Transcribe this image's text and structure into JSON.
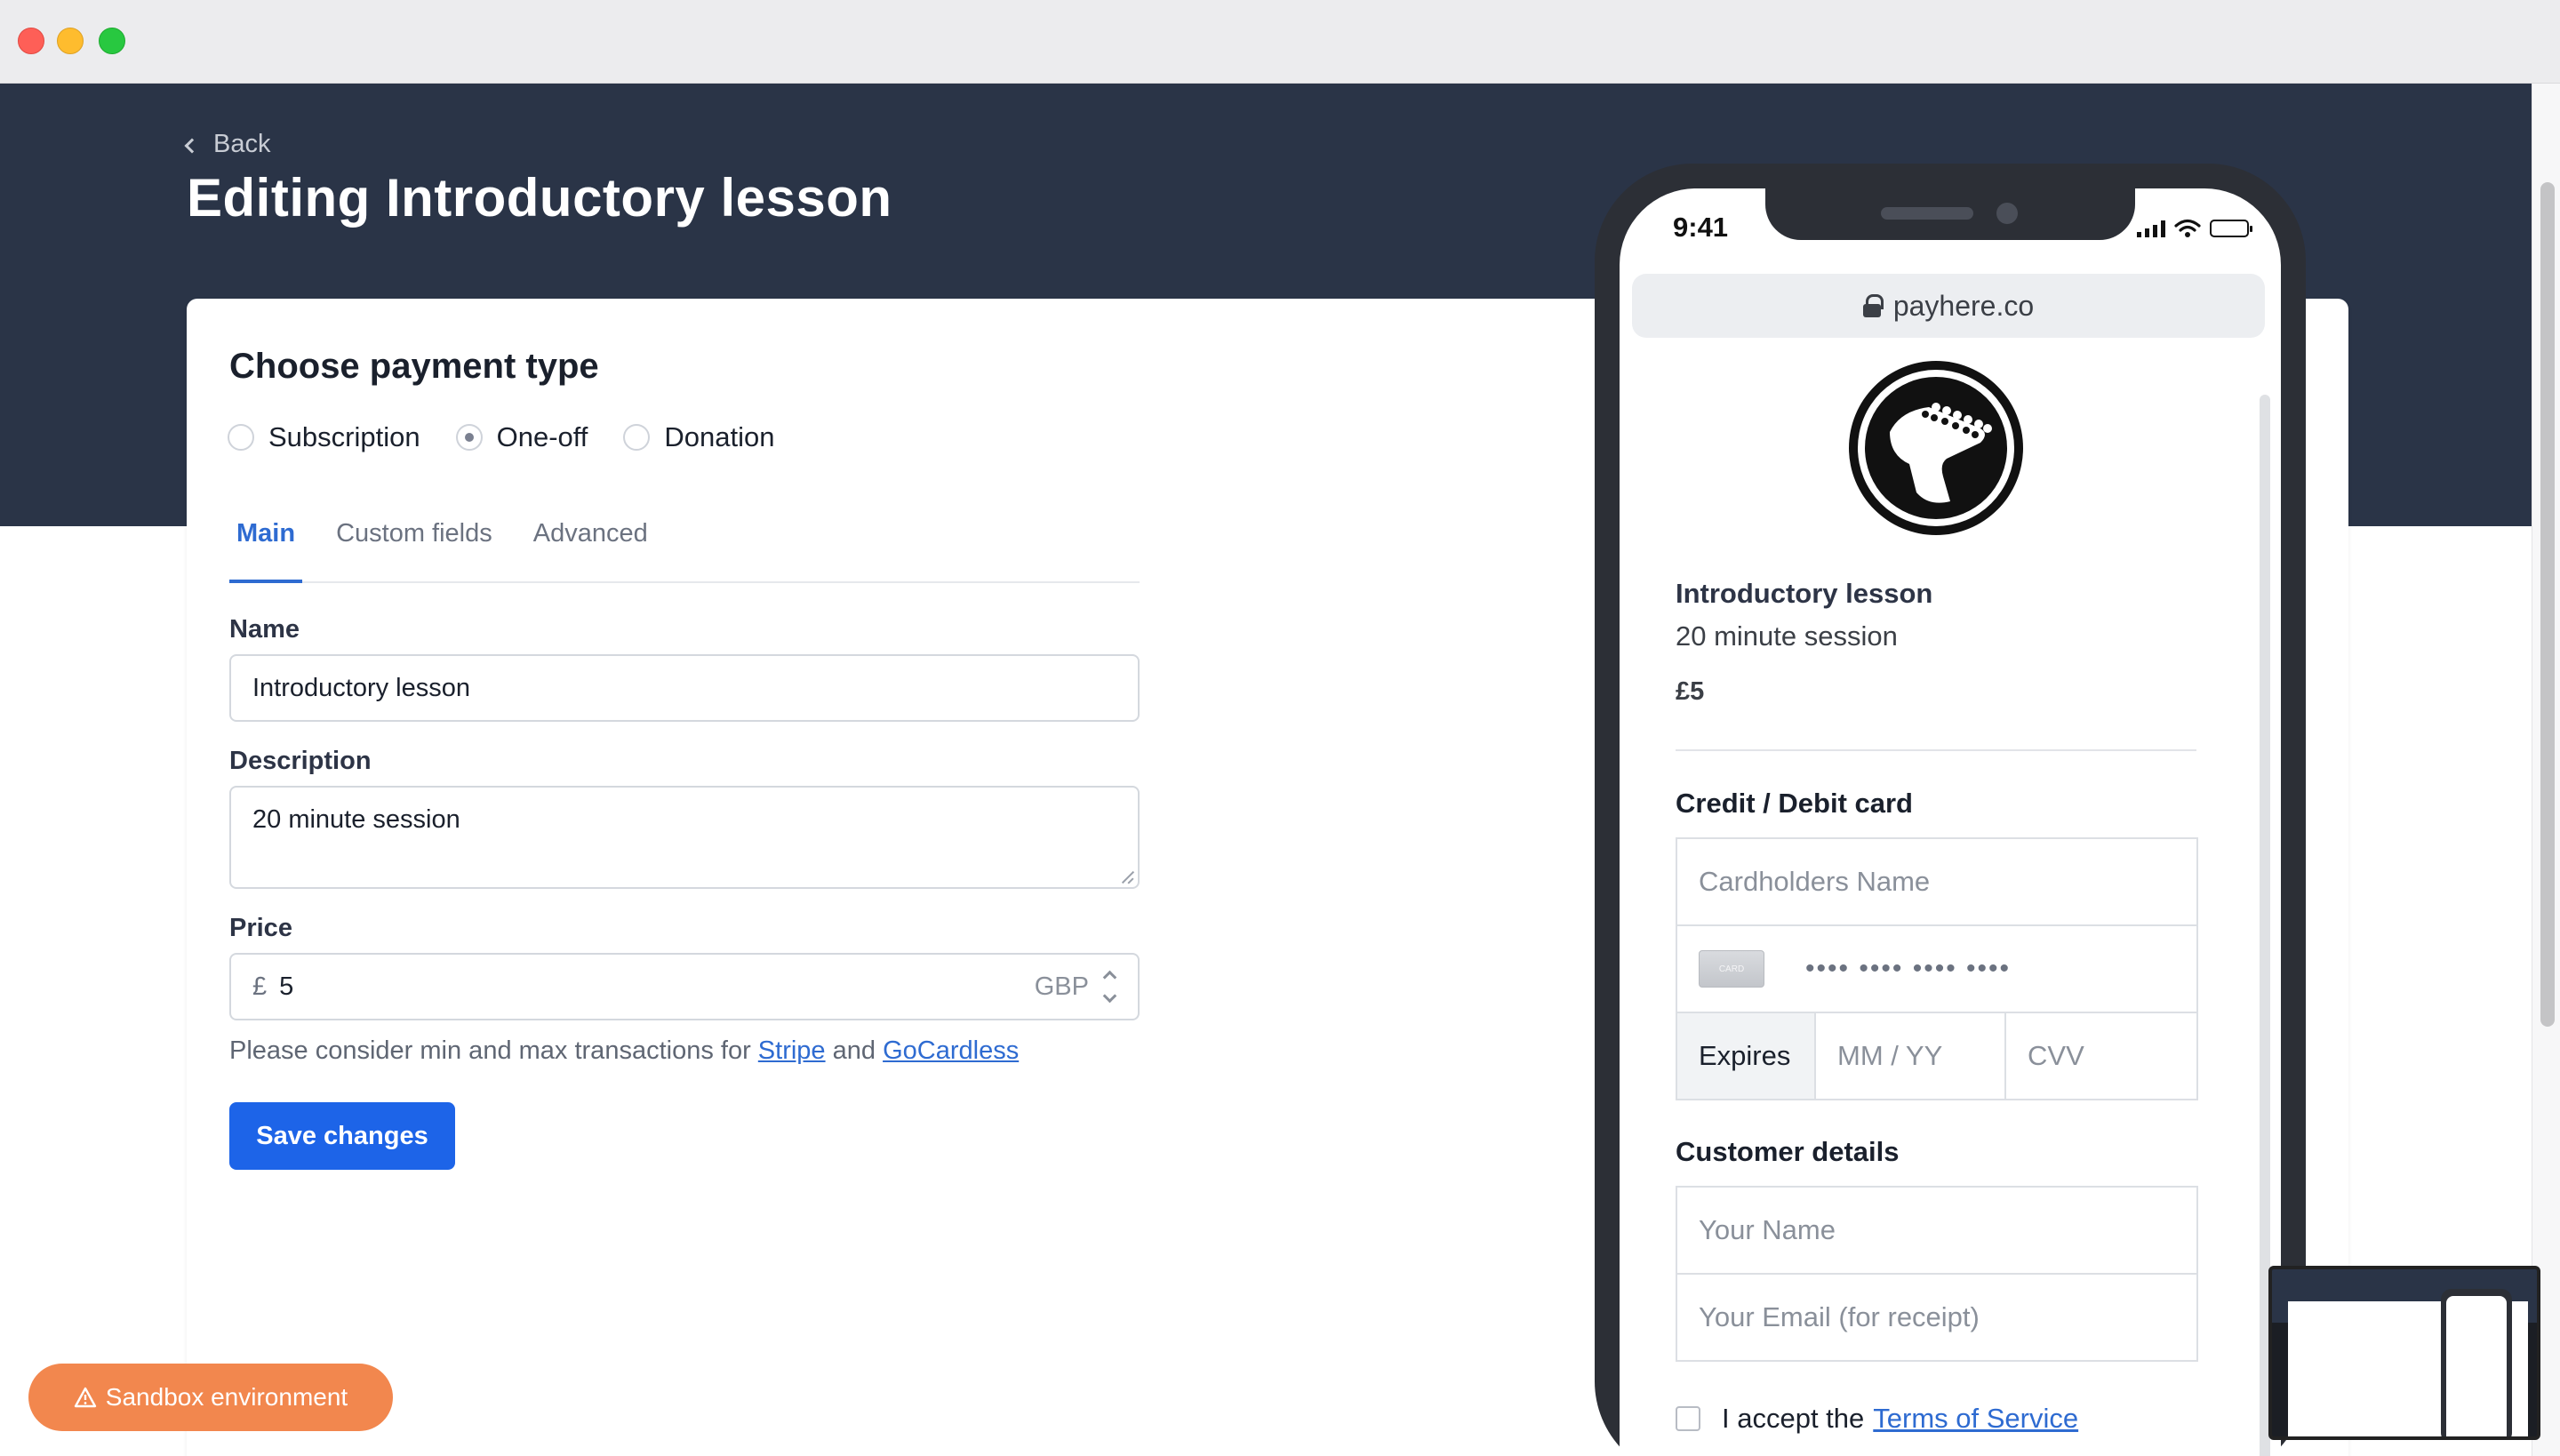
{
  "header": {
    "back_label": "Back",
    "title": "Editing Introductory lesson"
  },
  "form": {
    "section_title": "Choose payment type",
    "payment_types": [
      {
        "label": "Subscription",
        "checked": false
      },
      {
        "label": "One-off",
        "checked": true
      },
      {
        "label": "Donation",
        "checked": false
      }
    ],
    "tabs": [
      {
        "label": "Main",
        "active": true
      },
      {
        "label": "Custom fields",
        "active": false
      },
      {
        "label": "Advanced",
        "active": false
      }
    ],
    "name_label": "Name",
    "name_value": "Introductory lesson",
    "description_label": "Description",
    "description_value": "20 minute session",
    "price_label": "Price",
    "price_currency_symbol": "£",
    "price_value": "5",
    "price_currency_code": "GBP",
    "note_prefix": "Please consider min and max transactions for",
    "note_link_stripe": "Stripe",
    "note_and": "and",
    "note_link_gocardless": "GoCardless",
    "save_label": "Save changes"
  },
  "sandbox_label": "Sandbox environment",
  "phone": {
    "time": "9:41",
    "url": "payhere.co",
    "product_title": "Introductory lesson",
    "product_subtitle": "20 minute session",
    "product_price": "£5",
    "card_heading": "Credit / Debit card",
    "cardholder_placeholder": "Cardholders Name",
    "card_icon_text": "CARD",
    "card_number_placeholder": "•••• •••• •••• ••••",
    "expires_label": "Expires",
    "expiry_placeholder": "MM / YY",
    "cvv_placeholder": "CVV",
    "customer_heading": "Customer details",
    "name_placeholder": "Your Name",
    "email_placeholder": "Your Email (for receipt)",
    "accept_prefix": "I accept the",
    "terms_link": "Terms of Service"
  },
  "colors": {
    "header_band": "#2a3447",
    "accent": "#1d64e8",
    "link": "#2e6bd1",
    "sandbox": "#f2874e"
  },
  "icons": [
    "back-chevron-icon",
    "lock-icon",
    "signal-icon",
    "wifi-icon",
    "battery-icon",
    "guitar-logo-icon",
    "card-icon",
    "warning-icon",
    "select-arrows-icon"
  ]
}
